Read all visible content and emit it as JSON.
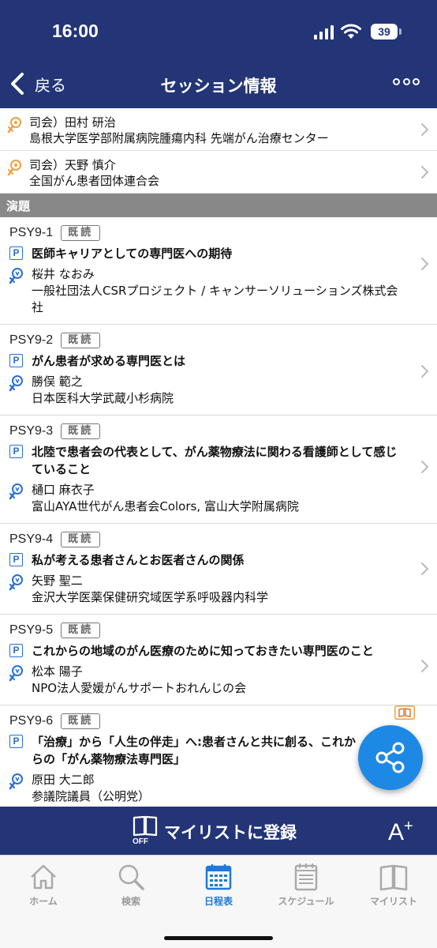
{
  "status_bar": {
    "time": "16:00",
    "battery": "39"
  },
  "nav": {
    "back_label": "戻る",
    "title": "セッション情報"
  },
  "chairs": [
    {
      "name": "司会）田村 研治",
      "affiliation": "島根大学医学部附属病院腫瘍内科 先端がん治療センター"
    },
    {
      "name": "司会）天野 慎介",
      "affiliation": "全国がん患者団体連合会"
    }
  ],
  "section_title": "演題",
  "read_badge": "既読",
  "presentations": [
    {
      "id": "PSY9-1",
      "title": "医師キャリアとしての専門医への期待",
      "speaker": "桜井 なおみ",
      "affiliation": "一般社団法人CSRプロジェクト / キャンサーソリューションズ株式会社"
    },
    {
      "id": "PSY9-2",
      "title": "がん患者が求める専門医とは",
      "speaker": "勝俣 範之",
      "affiliation": "日本医科大学武蔵小杉病院"
    },
    {
      "id": "PSY9-3",
      "title": "北陸で患者会の代表として、がん薬物療法に関わる看護師として感じていること",
      "speaker": "樋口 麻衣子",
      "affiliation": "富山AYA世代がん患者会Colors, 富山大学附属病院"
    },
    {
      "id": "PSY9-4",
      "title": "私が考える患者さんとお医者さんの関係",
      "speaker": "矢野 聖二",
      "affiliation": "金沢大学医薬保健研究域医学系呼吸器内科学"
    },
    {
      "id": "PSY9-5",
      "title": "これからの地域のがん医療のために知っておきたい専門医のこと",
      "speaker": "松本 陽子",
      "affiliation": "NPO法人愛媛がんサポートおれんじの会"
    },
    {
      "id": "PSY9-6",
      "title": "「治療」から「人生の伴走」へ:患者さんと共に創る、これからの「がん薬物療法専門医」",
      "speaker": "原田 大二郎",
      "affiliation": "参議院議員（公明党）"
    }
  ],
  "mylist_bar": {
    "label": "マイリストに登録",
    "off_label": "OFF",
    "font_button": "A",
    "font_plus": "+"
  },
  "tabs": [
    {
      "label": "ホーム",
      "icon": "home-icon"
    },
    {
      "label": "検索",
      "icon": "search-icon"
    },
    {
      "label": "日程表",
      "icon": "calendar-icon",
      "active": true
    },
    {
      "label": "スケジュール",
      "icon": "schedule-icon"
    },
    {
      "label": "マイリスト",
      "icon": "book-icon"
    }
  ],
  "colors": {
    "primary": "#233576",
    "accent": "#1e88e5",
    "chair_icon": "#f0a040",
    "speaker_icon": "#2a6fd6"
  }
}
